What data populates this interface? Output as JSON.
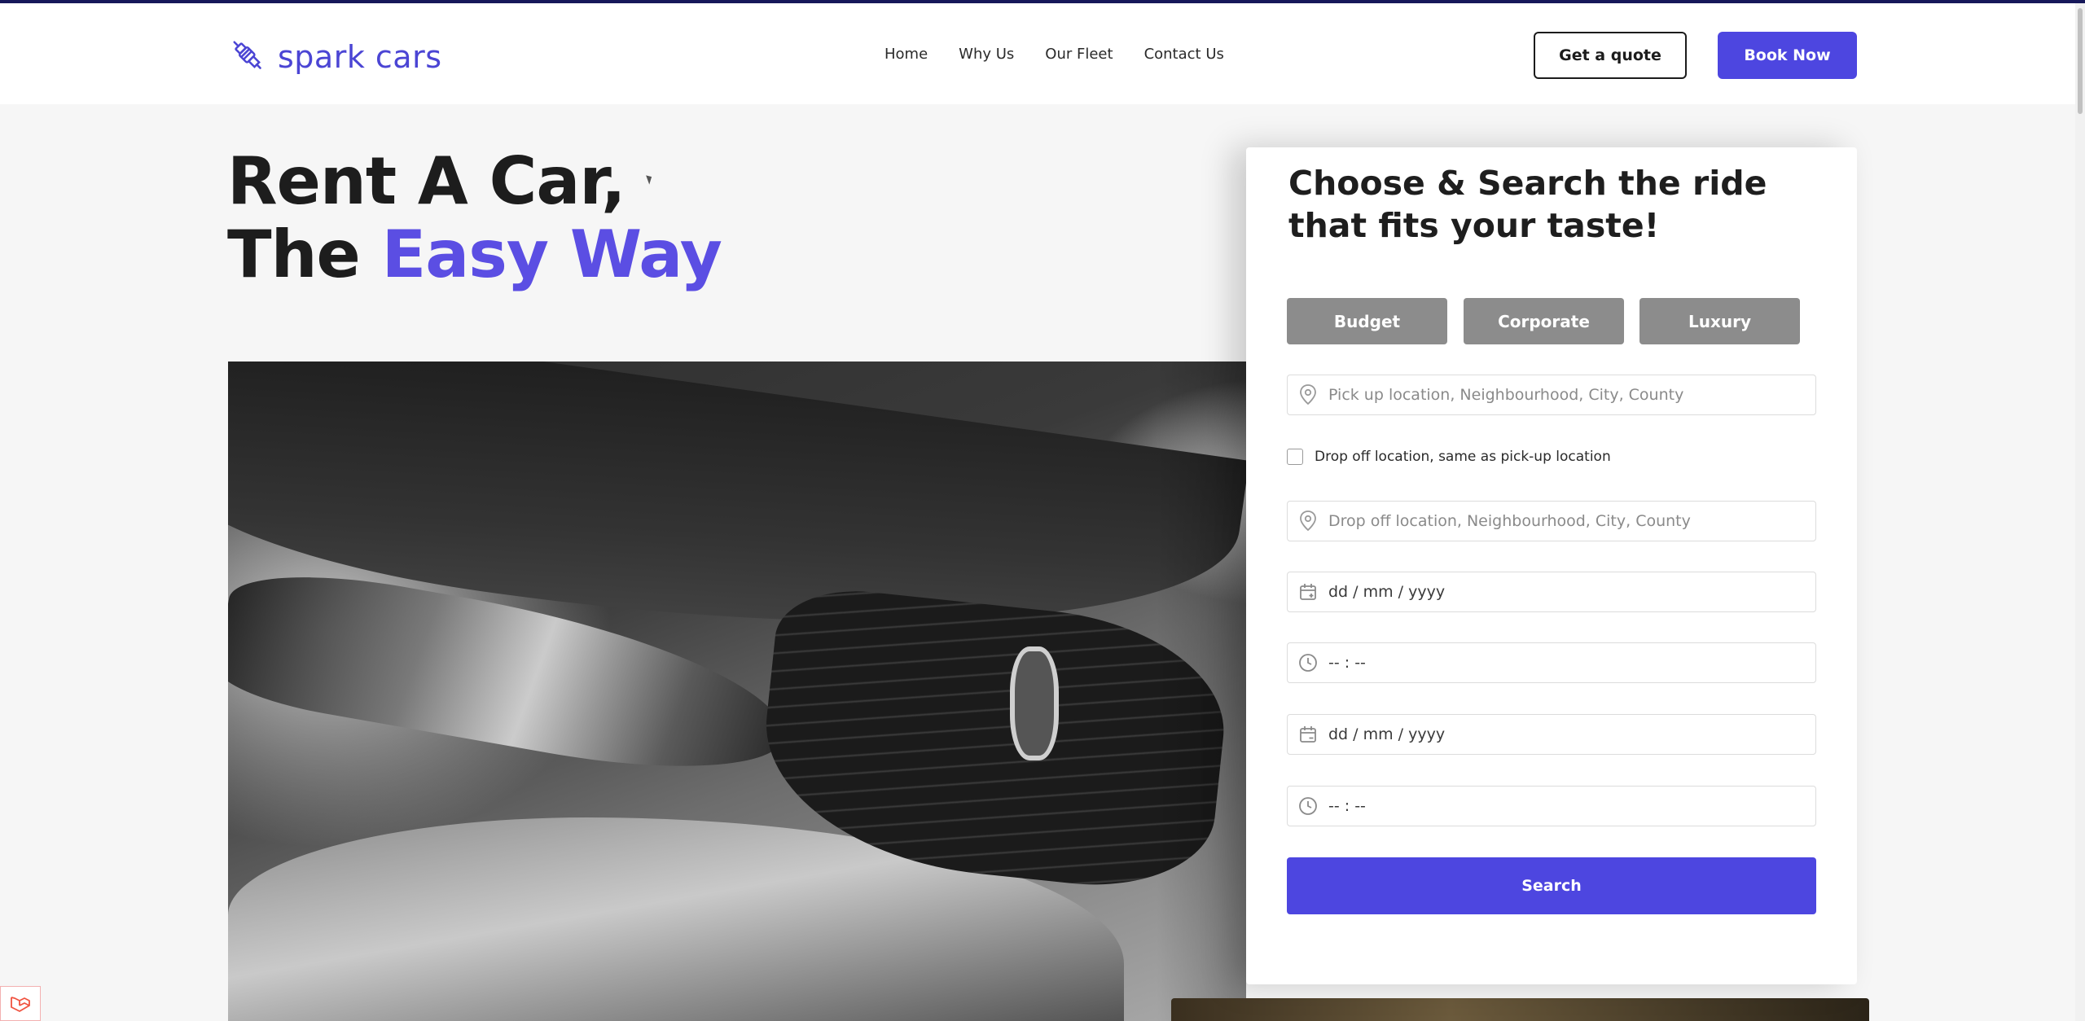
{
  "brand": {
    "name": "spark cars",
    "logo_icon": "spark-plug-icon",
    "accent": "#5b4ee3",
    "button_color": "#4d46e0"
  },
  "nav": {
    "items": [
      {
        "label": "Home"
      },
      {
        "label": "Why Us"
      },
      {
        "label": "Our Fleet"
      },
      {
        "label": "Contact Us"
      }
    ]
  },
  "header": {
    "quote_label": "Get a quote",
    "book_label": "Book Now"
  },
  "hero": {
    "line1": "Rent A Car,",
    "line2_prefix": "The ",
    "line2_accent": "Easy Way"
  },
  "search_card": {
    "title": "Choose & Search the ride that fits your taste!",
    "segments": [
      {
        "label": "Budget"
      },
      {
        "label": "Corporate"
      },
      {
        "label": "Luxury"
      }
    ],
    "pickup_placeholder": "Pick up location, Neighbourhood, City, County",
    "same_dropoff_label": "Drop off location, same as pick-up location",
    "dropoff_placeholder": "Drop off location, Neighbourhood, City, County",
    "pickup_date": "dd / mm / yyyy",
    "pickup_time": "-- : --",
    "return_date": "dd / mm / yyyy",
    "return_time": "-- : --",
    "search_label": "Search"
  }
}
